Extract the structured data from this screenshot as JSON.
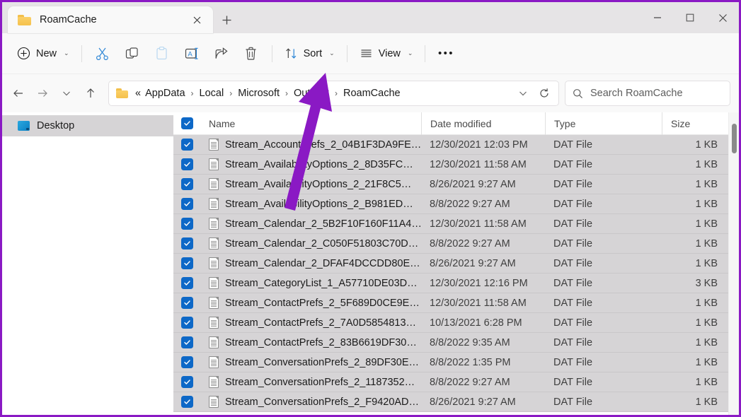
{
  "window": {
    "tab_title": "RoamCache",
    "tab_close_icon": "close-icon",
    "new_tab_icon": "plus-icon",
    "minimize_label": "─",
    "maximize_label": "□",
    "close_label": "✕",
    "annotation_color": "#8a19c4"
  },
  "toolbar": {
    "new_label": "New",
    "new_icon": "plus-circle-icon",
    "cut_icon": "scissors-icon",
    "copy_icon": "copy-icon",
    "paste_icon": "paste-icon",
    "rename_icon": "rename-icon",
    "share_icon": "share-icon",
    "delete_icon": "trash-icon",
    "sort_label": "Sort",
    "sort_icon": "sort-arrows-icon",
    "view_label": "View",
    "view_icon": "list-lines-icon",
    "more_label": "•••",
    "chevron": "⌄"
  },
  "address": {
    "back_icon": "arrow-left-icon",
    "forward_icon": "arrow-right-icon",
    "recent_icon": "chevron-down-icon",
    "up_icon": "arrow-up-icon",
    "folder_icon": "folder-icon",
    "overflow": "«",
    "crumbs": [
      "AppData",
      "Local",
      "Microsoft",
      "Outlook",
      "RoamCache"
    ],
    "separator": "›",
    "dropdown_icon": "chevron-down-icon",
    "refresh_icon": "refresh-icon"
  },
  "search": {
    "icon": "search-icon",
    "placeholder": "Search RoamCache"
  },
  "sidebar": {
    "items": [
      {
        "label": "Desktop",
        "icon": "monitor-icon",
        "selected": true
      }
    ]
  },
  "columns": {
    "select_all_checked": true,
    "name": "Name",
    "date_modified": "Date modified",
    "type": "Type",
    "size": "Size"
  },
  "files": [
    {
      "name": "Stream_AccountPrefs_2_04B1F3DA9FE…",
      "date": "12/30/2021 12:03 PM",
      "type": "DAT File",
      "size": "1 KB",
      "checked": true
    },
    {
      "name": "Stream_AvailabilityOptions_2_8D35FC…",
      "date": "12/30/2021 11:58 AM",
      "type": "DAT File",
      "size": "1 KB",
      "checked": true
    },
    {
      "name": "Stream_AvailabilityOptions_2_21F8C5…",
      "date": "8/26/2021 9:27 AM",
      "type": "DAT File",
      "size": "1 KB",
      "checked": true
    },
    {
      "name": "Stream_AvailabilityOptions_2_B981ED…",
      "date": "8/8/2022 9:27 AM",
      "type": "DAT File",
      "size": "1 KB",
      "checked": true
    },
    {
      "name": "Stream_Calendar_2_5B2F10F160F11A4…",
      "date": "12/30/2021 11:58 AM",
      "type": "DAT File",
      "size": "1 KB",
      "checked": true
    },
    {
      "name": "Stream_Calendar_2_C050F51803C70D…",
      "date": "8/8/2022 9:27 AM",
      "type": "DAT File",
      "size": "1 KB",
      "checked": true
    },
    {
      "name": "Stream_Calendar_2_DFAF4DCCDD80E…",
      "date": "8/26/2021 9:27 AM",
      "type": "DAT File",
      "size": "1 KB",
      "checked": true
    },
    {
      "name": "Stream_CategoryList_1_A57710DE03D…",
      "date": "12/30/2021 12:16 PM",
      "type": "DAT File",
      "size": "3 KB",
      "checked": true
    },
    {
      "name": "Stream_ContactPrefs_2_5F689D0CE9E…",
      "date": "12/30/2021 11:58 AM",
      "type": "DAT File",
      "size": "1 KB",
      "checked": true
    },
    {
      "name": "Stream_ContactPrefs_2_7A0D5854813…",
      "date": "10/13/2021 6:28 PM",
      "type": "DAT File",
      "size": "1 KB",
      "checked": true
    },
    {
      "name": "Stream_ContactPrefs_2_83B6619DF30…",
      "date": "8/8/2022 9:35 AM",
      "type": "DAT File",
      "size": "1 KB",
      "checked": true
    },
    {
      "name": "Stream_ConversationPrefs_2_89DF30E…",
      "date": "8/8/2022 1:35 PM",
      "type": "DAT File",
      "size": "1 KB",
      "checked": true
    },
    {
      "name": "Stream_ConversationPrefs_2_1187352…",
      "date": "8/8/2022 9:27 AM",
      "type": "DAT File",
      "size": "1 KB",
      "checked": true
    },
    {
      "name": "Stream_ConversationPrefs_2_F9420AD…",
      "date": "8/26/2021 9:27 AM",
      "type": "DAT File",
      "size": "1 KB",
      "checked": true
    }
  ]
}
